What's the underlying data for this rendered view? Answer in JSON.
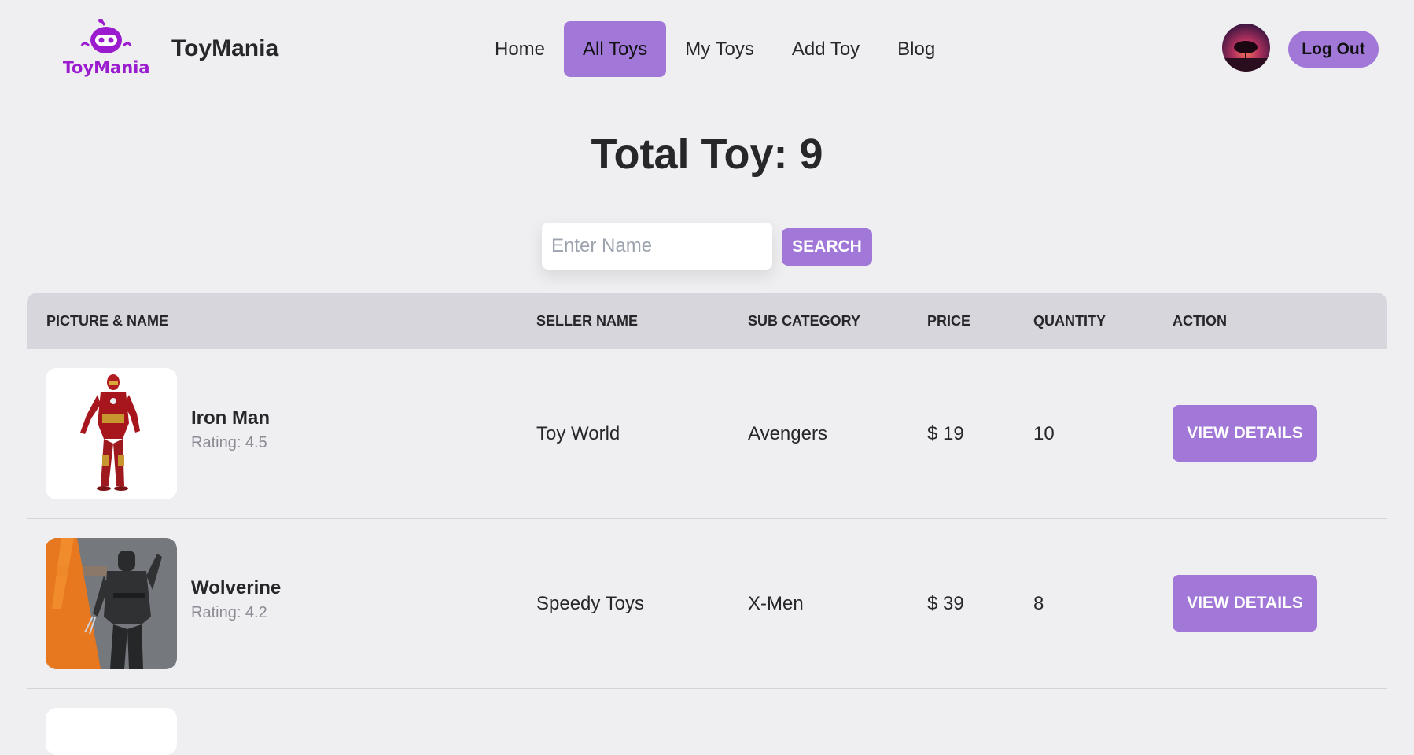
{
  "brand": {
    "logo_text": "ToyMania",
    "name": "ToyMania"
  },
  "nav": {
    "items": [
      {
        "label": "Home"
      },
      {
        "label": "All Toys"
      },
      {
        "label": "My Toys"
      },
      {
        "label": "Add Toy"
      },
      {
        "label": "Blog"
      }
    ],
    "active": "All Toys"
  },
  "user": {
    "logout_label": "Log Out"
  },
  "page": {
    "title": "Total Toy: 9"
  },
  "search": {
    "placeholder": "Enter Name",
    "value": "",
    "button_label": "SEARCH"
  },
  "table": {
    "headers": {
      "picture_name": "PICTURE & NAME",
      "seller": "SELLER NAME",
      "subcategory": "SUB CATEGORY",
      "price": "PRICE",
      "quantity": "QUANTITY",
      "action": "ACTION"
    },
    "rows": [
      {
        "name": "Iron Man",
        "rating": "Rating: 4.5",
        "seller": "Toy World",
        "subcategory": "Avengers",
        "price": "$ 19",
        "quantity": "10",
        "action": "VIEW DETAILS"
      },
      {
        "name": "Wolverine",
        "rating": "Rating: 4.2",
        "seller": "Speedy Toys",
        "subcategory": "X-Men",
        "price": "$ 39",
        "quantity": "8",
        "action": "VIEW DETAILS"
      }
    ]
  },
  "colors": {
    "accent": "#a178d7",
    "background": "#efeff2",
    "table_header": "#d7d6dc",
    "logo_purple": "#9b1ccf"
  }
}
